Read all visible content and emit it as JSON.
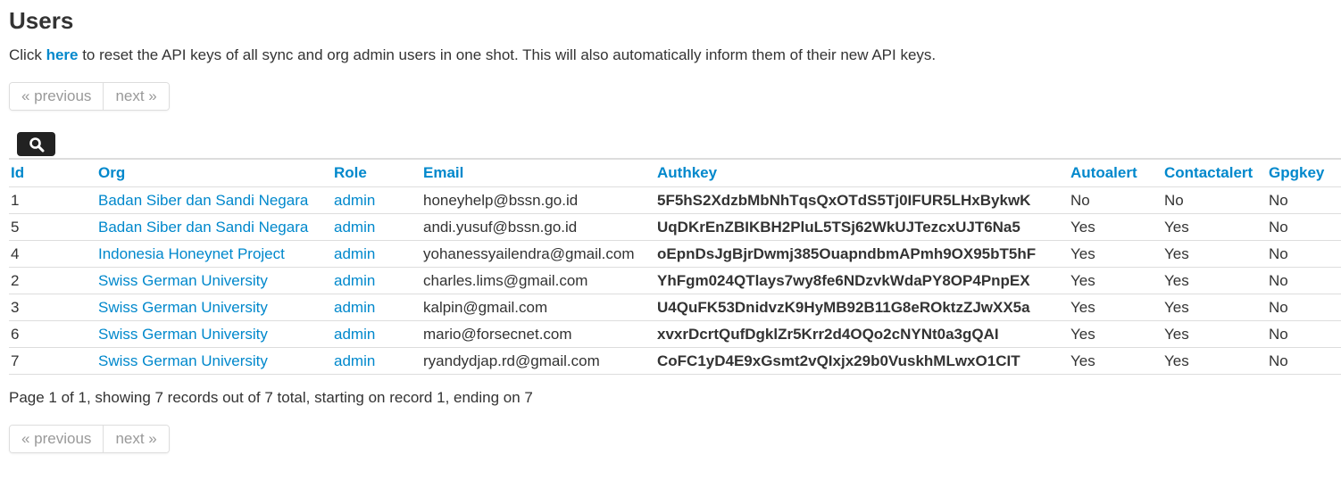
{
  "page": {
    "title": "Users",
    "intro_prefix": "Click ",
    "intro_link": "here",
    "intro_suffix": " to reset the API keys of all sync and org admin users in one shot. This will also automatically inform them of their new API keys."
  },
  "pager": {
    "previous": "« previous",
    "next": "next »"
  },
  "search": {
    "icon": "search-icon"
  },
  "table": {
    "headers": {
      "id": "Id",
      "org": "Org",
      "role": "Role",
      "email": "Email",
      "authkey": "Authkey",
      "autoalert": "Autoalert",
      "contactalert": "Contactalert",
      "gpgkey": "Gpgkey"
    },
    "rows": [
      {
        "id": "1",
        "org": "Badan Siber dan Sandi Negara",
        "role": "admin",
        "email": "honeyhelp@bssn.go.id",
        "authkey": "5F5hS2XdzbMbNhTqsQxOTdS5Tj0IFUR5LHxBykwK",
        "autoalert": "No",
        "contactalert": "No",
        "gpgkey": "No"
      },
      {
        "id": "5",
        "org": "Badan Siber dan Sandi Negara",
        "role": "admin",
        "email": "andi.yusuf@bssn.go.id",
        "authkey": "UqDKrEnZBIKBH2PluL5TSj62WkUJTezcxUJT6Na5",
        "autoalert": "Yes",
        "contactalert": "Yes",
        "gpgkey": "No"
      },
      {
        "id": "4",
        "org": "Indonesia Honeynet Project",
        "role": "admin",
        "email": "yohanessyailendra@gmail.com",
        "authkey": "oEpnDsJgBjrDwmj385OuapndbmAPmh9OX95bT5hF",
        "autoalert": "Yes",
        "contactalert": "Yes",
        "gpgkey": "No"
      },
      {
        "id": "2",
        "org": "Swiss German University",
        "role": "admin",
        "email": "charles.lims@gmail.com",
        "authkey": "YhFgm024QTlays7wy8fe6NDzvkWdaPY8OP4PnpEX",
        "autoalert": "Yes",
        "contactalert": "Yes",
        "gpgkey": "No"
      },
      {
        "id": "3",
        "org": "Swiss German University",
        "role": "admin",
        "email": "kalpin@gmail.com",
        "authkey": "U4QuFK53DnidvzK9HyMB92B11G8eROktzZJwXX5a",
        "autoalert": "Yes",
        "contactalert": "Yes",
        "gpgkey": "No"
      },
      {
        "id": "6",
        "org": "Swiss German University",
        "role": "admin",
        "email": "mario@forsecnet.com",
        "authkey": "xvxrDcrtQufDgklZr5Krr2d4OQo2cNYNt0a3gQAI",
        "autoalert": "Yes",
        "contactalert": "Yes",
        "gpgkey": "No"
      },
      {
        "id": "7",
        "org": "Swiss German University",
        "role": "admin",
        "email": "ryandydjap.rd@gmail.com",
        "authkey": "CoFC1yD4E9xGsmt2vQIxjx29b0VuskhMLwxO1CIT",
        "autoalert": "Yes",
        "contactalert": "Yes",
        "gpgkey": "No"
      }
    ]
  },
  "summary": "Page 1 of 1, showing 7 records out of 7 total, starting on record 1, ending on 7",
  "colors": {
    "link": "#0088cc",
    "text": "#333333",
    "border": "#dddddd",
    "disabled": "#999999",
    "search_button": "#222222"
  }
}
